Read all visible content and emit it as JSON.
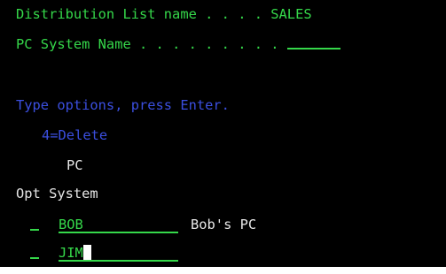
{
  "header": {
    "distribution_list": {
      "label": "Distribution List name",
      "dots": " . . . . ",
      "value": "SALES"
    },
    "pc_system_name": {
      "label": "PC System Name",
      "dots": " . . . . . . . . .",
      "value": ""
    }
  },
  "instructions": {
    "prompt": "Type options, press Enter.",
    "option_4": "4=Delete"
  },
  "columns": {
    "pc_header": "PC",
    "opt_header": "Opt",
    "system_header": "System"
  },
  "rows": [
    {
      "opt": "_",
      "system": "BOB",
      "description": "Bob's PC"
    },
    {
      "opt": "_",
      "system": "JIM",
      "description": ""
    }
  ],
  "colors": {
    "field_green": "#35d84a",
    "instruction_blue": "#3b4fe0",
    "heading_white": "#e6e6e6",
    "background": "#000000"
  }
}
